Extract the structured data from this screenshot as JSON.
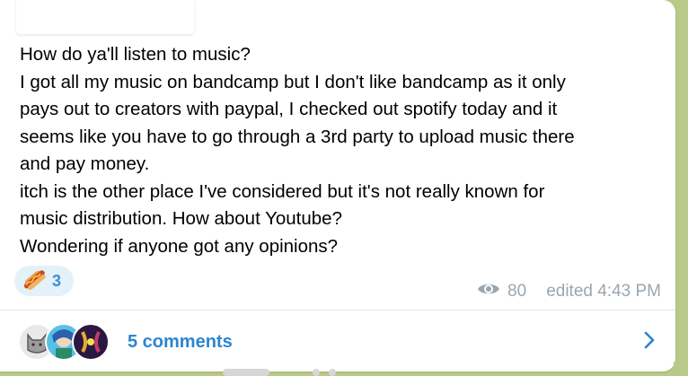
{
  "post": {
    "lines": [
      "How do ya'll listen to music?",
      "I got all my music on bandcamp but I don't like bandcamp as it only",
      "pays out to creators with paypal, I checked out spotify today and it",
      "seems like you have to go through a 3rd party to upload music there",
      "and pay money.",
      "itch is the other place I've considered but it's not really known for",
      "music distribution. How about Youtube?",
      "Wondering if anyone got any opinions?"
    ]
  },
  "reaction": {
    "icon": "hotdog-icon",
    "count": "3"
  },
  "meta": {
    "views": "80",
    "edited": "edited 4:43 PM",
    "views_icon": "eye-icon"
  },
  "comments": {
    "label": "5 comments",
    "chevron_icon": "chevron-right-icon"
  },
  "colors": {
    "accent": "#2b85d0",
    "reaction_bg": "#e3f1f9",
    "meta_text": "#9aa6b0",
    "chat_background": "#b8c98a"
  }
}
